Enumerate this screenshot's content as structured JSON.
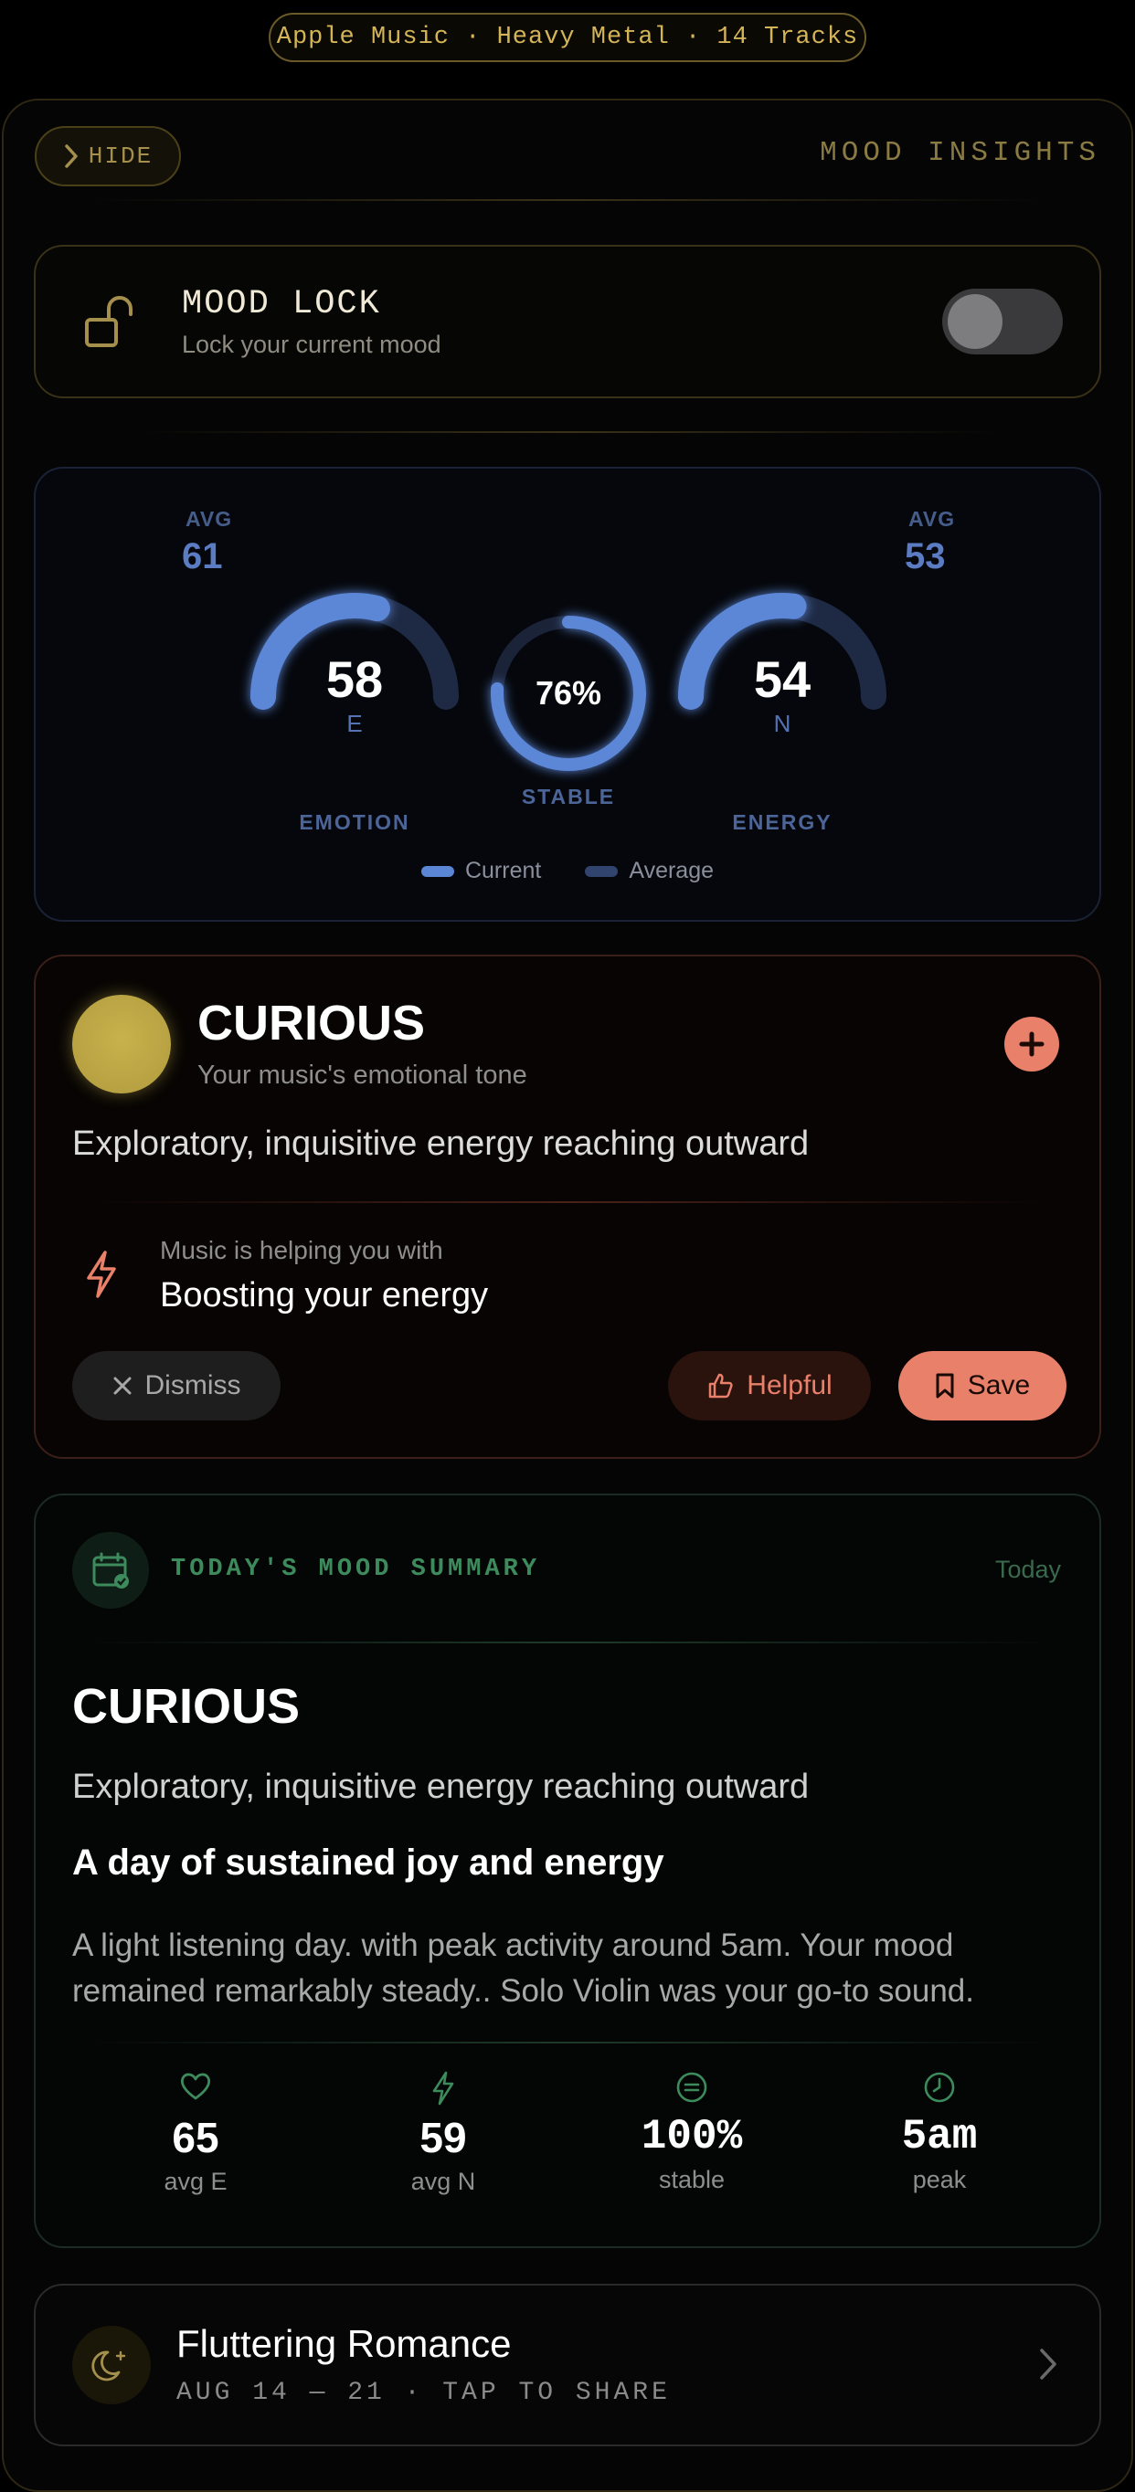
{
  "source_pill": "Apple Music · Heavy Metal · 14 Tracks",
  "header": {
    "hide_label": "HIDE",
    "title": "MOOD INSIGHTS"
  },
  "mood_lock": {
    "title": "MOOD LOCK",
    "subtitle": "Lock your current mood",
    "enabled": false
  },
  "gauges": {
    "emotion": {
      "avg_label": "AVG",
      "avg_value": "61",
      "value": "58",
      "letter": "E",
      "name": "EMOTION",
      "fraction": 0.58,
      "avg_fraction": 0.61
    },
    "stability": {
      "value": "76%",
      "name": "STABLE",
      "fraction": 0.76
    },
    "energy": {
      "avg_label": "AVG",
      "avg_value": "53",
      "value": "54",
      "letter": "N",
      "name": "ENERGY",
      "fraction": 0.54,
      "avg_fraction": 0.53
    },
    "legend_current": "Current",
    "legend_average": "Average"
  },
  "mood": {
    "title": "CURIOUS",
    "subtitle": "Your music's emotional tone",
    "description": "Exploratory, inquisitive energy reaching outward",
    "helping_label": "Music is helping you with",
    "helping_value": "Boosting your energy",
    "dismiss_label": "Dismiss",
    "helpful_label": "Helpful",
    "save_label": "Save"
  },
  "summary": {
    "heading": "TODAY'S MOOD SUMMARY",
    "date": "Today",
    "title": "CURIOUS",
    "description": "Exploratory, inquisitive energy reaching outward",
    "headline": "A day of sustained joy and energy",
    "paragraph": "A light listening day. with peak activity around 5am. Your mood remained remarkably steady.. Solo Violin was your go-to sound.",
    "stats": [
      {
        "icon": "heart-icon",
        "value": "65",
        "label": "avg E"
      },
      {
        "icon": "bolt-icon",
        "value": "59",
        "label": "avg N"
      },
      {
        "icon": "equals-icon",
        "value": "100%",
        "label": "stable"
      },
      {
        "icon": "clock-icon",
        "value": "5am",
        "label": "peak"
      }
    ]
  },
  "romance": {
    "title": "Fluttering Romance",
    "subtitle": "AUG 14 — 21 · TAP TO SHARE"
  },
  "colors": {
    "accent_gold": "#d4b458",
    "accent_blue": "#5b86d6",
    "accent_coral": "#e8806a",
    "accent_green": "#3d8a5c"
  }
}
